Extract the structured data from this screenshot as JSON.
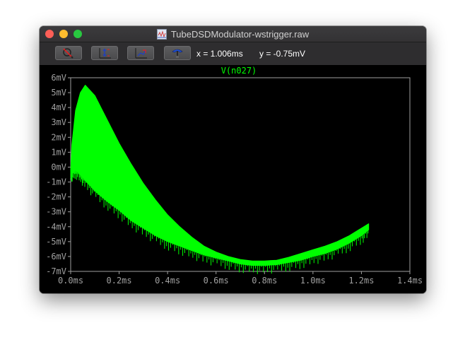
{
  "window": {
    "title": "TubeDSDModulator-wstrigger.raw"
  },
  "toolbar": {
    "buttons": [
      {
        "icon": "zoom-reset-icon"
      },
      {
        "icon": "autorange-y-icon"
      },
      {
        "icon": "zoom-out-icon"
      },
      {
        "icon": "cursor-probe-icon"
      }
    ],
    "cursor_x": "x = 1.006ms",
    "cursor_y": "y = -0.75mV"
  },
  "colors": {
    "trace": "#00ff00",
    "axis": "#a0a0a0",
    "background": "#000000"
  },
  "chart_data": {
    "type": "line",
    "title": "V(n027)",
    "xlabel": "",
    "ylabel": "",
    "xlim": [
      0.0,
      1.4
    ],
    "ylim": [
      -7,
      6
    ],
    "x_ticks": [
      "0.0ms",
      "0.2ms",
      "0.4ms",
      "0.6ms",
      "0.8ms",
      "1.0ms",
      "1.2ms",
      "1.4ms"
    ],
    "y_ticks": [
      "6mV",
      "5mV",
      "4mV",
      "3mV",
      "2mV",
      "1mV",
      "0mV",
      "-1mV",
      "-2mV",
      "-3mV",
      "-4mV",
      "-5mV",
      "-6mV",
      "-7mV"
    ],
    "series": [
      {
        "name": "V(n027)",
        "x": [
          0.0,
          0.005,
          0.02,
          0.04,
          0.06,
          0.1,
          0.15,
          0.2,
          0.25,
          0.3,
          0.35,
          0.4,
          0.45,
          0.5,
          0.55,
          0.6,
          0.65,
          0.7,
          0.75,
          0.8,
          0.85,
          0.9,
          0.95,
          1.0,
          1.05,
          1.1,
          1.15,
          1.2,
          1.23
        ],
        "upper": [
          -0.3,
          1.5,
          3.8,
          5.0,
          5.5,
          4.8,
          3.2,
          1.6,
          0.2,
          -1.1,
          -2.2,
          -3.2,
          -4.0,
          -4.7,
          -5.3,
          -5.7,
          -6.0,
          -6.2,
          -6.3,
          -6.3,
          -6.25,
          -6.05,
          -5.8,
          -5.55,
          -5.3,
          -5.0,
          -4.6,
          -4.1,
          -3.8
        ],
        "lower": [
          -0.4,
          -0.4,
          -0.2,
          -0.5,
          -0.9,
          -1.6,
          -2.3,
          -2.9,
          -3.6,
          -4.1,
          -4.6,
          -5.0,
          -5.3,
          -5.6,
          -5.9,
          -6.1,
          -6.3,
          -6.5,
          -6.6,
          -6.6,
          -6.55,
          -6.4,
          -6.25,
          -6.0,
          -5.8,
          -5.5,
          -5.1,
          -4.6,
          -4.2
        ]
      }
    ],
    "grid": false,
    "legend": "top-center"
  }
}
